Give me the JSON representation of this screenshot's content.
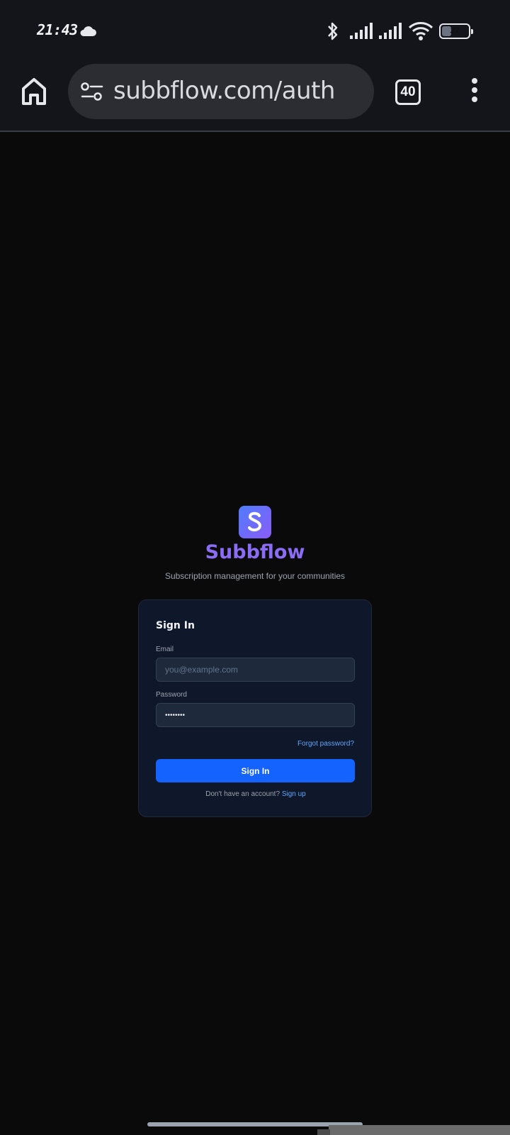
{
  "status_bar": {
    "time": "21:43",
    "battery": "37",
    "battery_level": 0.37
  },
  "browser": {
    "url": "subbflow.com/auth",
    "tab_count": "40"
  },
  "app": {
    "logo_letter": "S",
    "name": "Subbflow",
    "tagline": "Subscription management for your communities"
  },
  "signin": {
    "title": "Sign In",
    "email_label": "Email",
    "email_placeholder": "you@example.com",
    "password_label": "Password",
    "password_value": "••••••••",
    "forgot_label": "Forgot password?",
    "submit_label": "Sign In",
    "no_account_text": "Don't have an account?",
    "signup_label": "Sign up"
  },
  "colors": {
    "brand": "#8b6df5",
    "primary_button": "#1463ff",
    "link": "#60a5fa",
    "card_bg": "#0f172a"
  }
}
